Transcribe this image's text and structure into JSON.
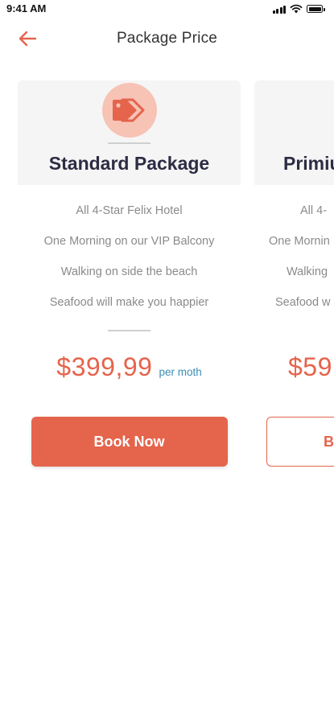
{
  "status_bar": {
    "time": "9:41 AM",
    "icons": [
      "signal-icon",
      "wifi-icon",
      "battery-icon"
    ]
  },
  "nav": {
    "back_icon": "arrow-left-icon",
    "title": "Package Price"
  },
  "colors": {
    "accent": "#e5644c",
    "accent_light": "#f7c3b5",
    "period_text": "#3a8fb5",
    "card_header_bg": "#f5f5f5",
    "heading": "#2c2c44",
    "muted_text": "#8a8a8a"
  },
  "packages": [
    {
      "icon": "price-tag-icon",
      "name": "Standard Package",
      "features": [
        "All 4-Star Felix Hotel",
        "One Morning on our VIP Balcony",
        "Walking on side the beach",
        "Seafood will make you happier"
      ],
      "price": "$399,99",
      "period": "per moth",
      "button_label": "Book Now"
    },
    {
      "name": "Primiu",
      "features": [
        "All 4-",
        "One Mornin",
        "Walking",
        "Seafood w"
      ],
      "price": "$59",
      "button_label": "B"
    }
  ]
}
